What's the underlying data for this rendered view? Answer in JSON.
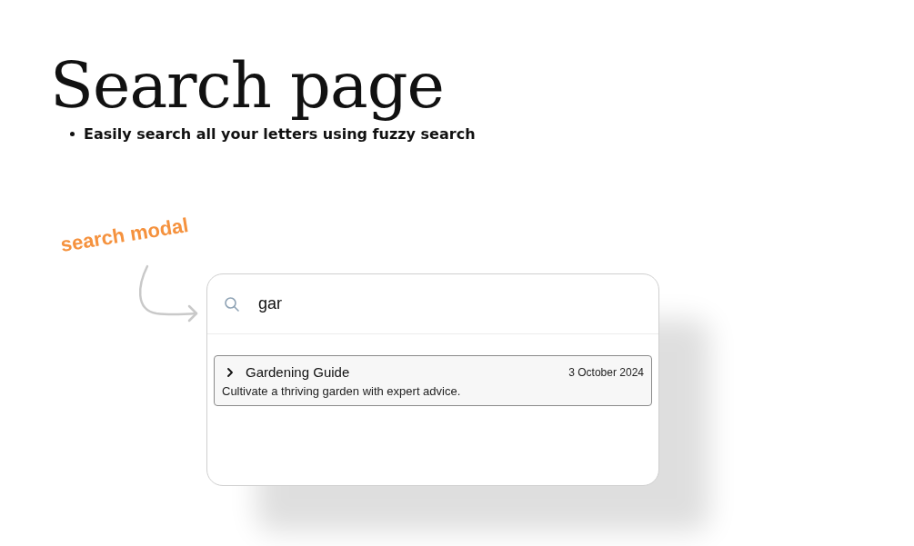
{
  "title": "Search page",
  "bullets": [
    "Easily search all your letters using fuzzy search"
  ],
  "annotation": "search modal",
  "search": {
    "value": "gar"
  },
  "results": [
    {
      "title": "Gardening Guide",
      "date": "3 October 2024",
      "excerpt": "Cultivate a thriving garden with expert advice.",
      "selected": true,
      "expanded": false
    }
  ]
}
